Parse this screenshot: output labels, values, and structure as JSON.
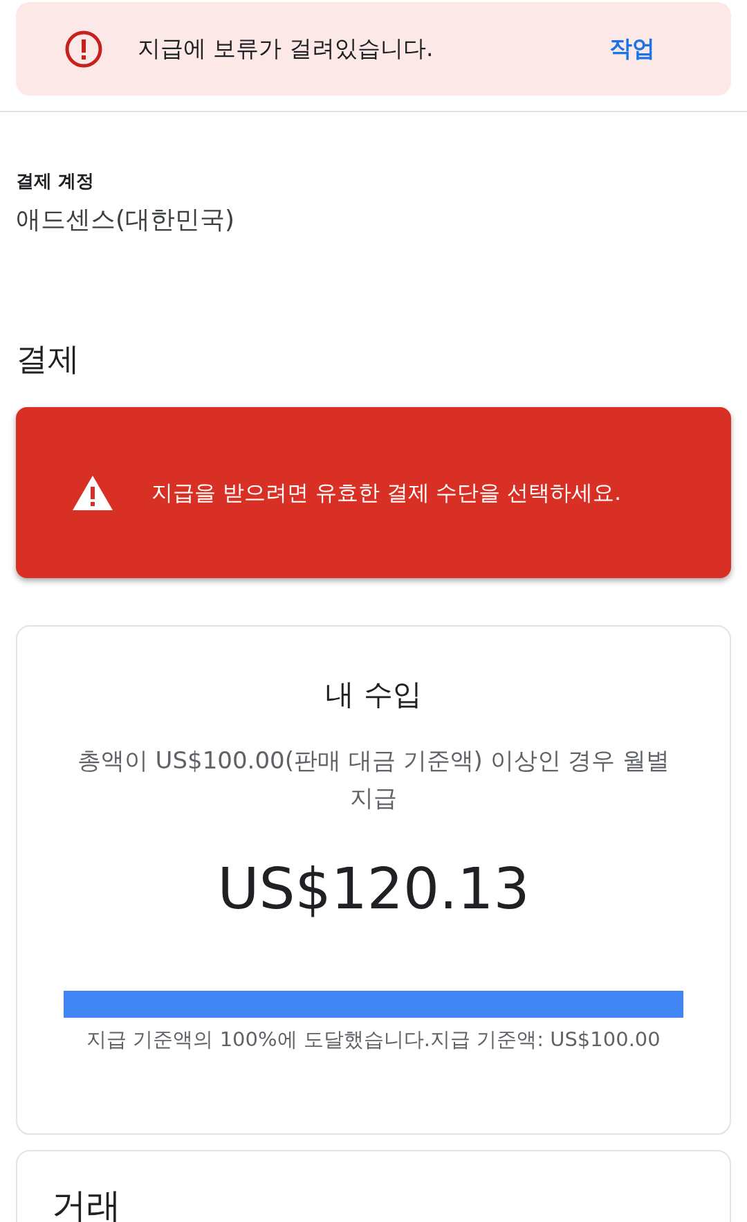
{
  "hold_banner": {
    "message": "지급에 보류가 걸려있습니다.",
    "action": "작업"
  },
  "payment_account": {
    "label": "결제 계정",
    "value": "애드센스(대한민국)"
  },
  "payments": {
    "title": "결제",
    "alert": {
      "message": "지급을 받으려면 유효한 결제 수단을 선택하세요."
    }
  },
  "earnings": {
    "title": "내 수입",
    "description": "총액이 US$100.00(판매 대금 기준액) 이상인 경우 월별 지급",
    "amount": "US$120.13",
    "level": 1,
    "caption": "지급 기준액의 100%에 도달했습니다.지급 기준액: US$100.00"
  },
  "transactions": {
    "title": "거래"
  }
}
